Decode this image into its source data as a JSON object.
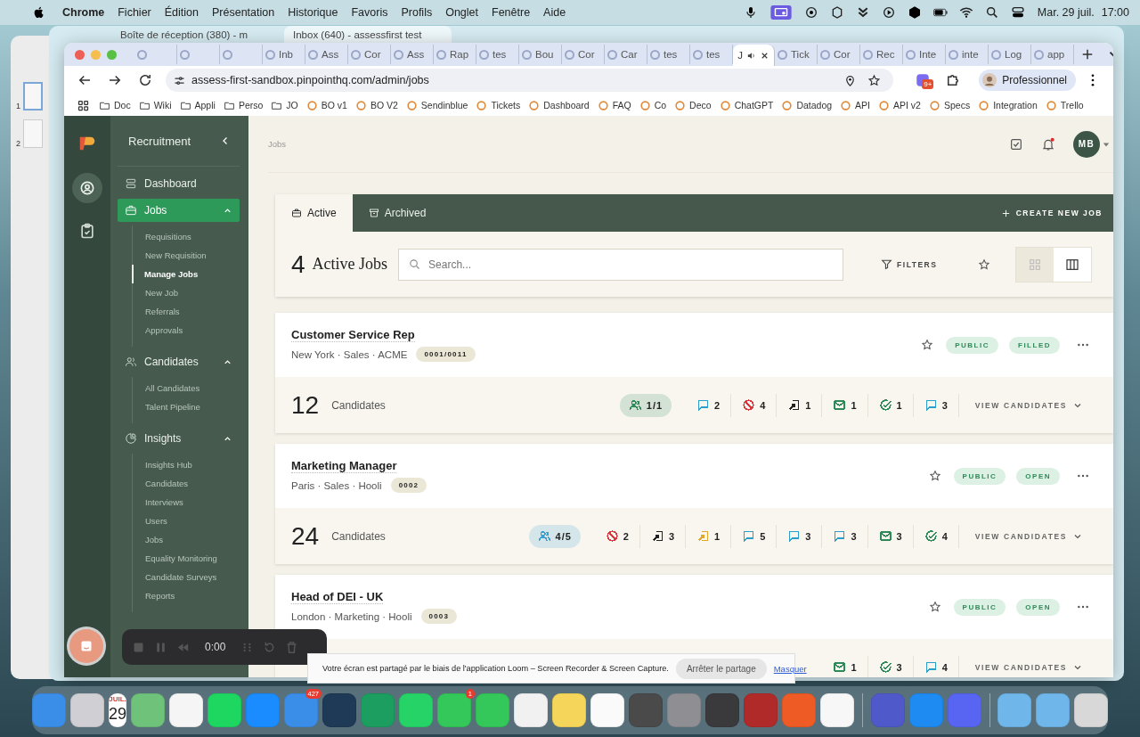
{
  "menu_bar": {
    "app": "Chrome",
    "menus": [
      "Fichier",
      "Édition",
      "Présentation",
      "Historique",
      "Favoris",
      "Profils",
      "Onglet",
      "Fenêtre",
      "Aide"
    ],
    "date": "Mar. 29 juil.",
    "time": "17:00"
  },
  "back_window": {
    "slides": [
      {
        "number": "1",
        "selected": true
      },
      {
        "number": "2",
        "selected": false
      }
    ],
    "tabs": [
      {
        "title": "Boîte de réception (380) - m",
        "selected": false
      },
      {
        "title": "Inbox (640) - assessfirst test",
        "selected": true
      }
    ]
  },
  "browser": {
    "tabs": [
      {
        "selected": false
      },
      {
        "selected": false
      },
      {
        "selected": false
      },
      {
        "label": "Inb",
        "selected": false
      },
      {
        "label": "Ass",
        "selected": false
      },
      {
        "label": "Cor",
        "selected": false
      },
      {
        "label": "Ass",
        "selected": false
      },
      {
        "label": "Rap",
        "selected": false
      },
      {
        "label": "tes",
        "selected": false
      },
      {
        "label": "Bou",
        "selected": false
      },
      {
        "label": "Cor",
        "selected": false
      },
      {
        "label": "Car",
        "selected": false
      },
      {
        "label": "tes",
        "selected": false
      },
      {
        "label": "tes",
        "selected": false
      },
      {
        "label": "J",
        "selected": true
      },
      {
        "label": "Tick",
        "selected": false
      },
      {
        "label": "Cor",
        "selected": false
      },
      {
        "label": "Rec",
        "selected": false
      },
      {
        "label": "Inte",
        "selected": false
      },
      {
        "label": "inte",
        "selected": false
      },
      {
        "label": "Log",
        "selected": false
      },
      {
        "label": "app",
        "selected": false
      }
    ],
    "url": "assess-first-sandbox.pinpointhq.com/admin/jobs",
    "extension_badge": "9+",
    "profile": "Professionnel",
    "bookmarks": [
      {
        "kind": "folder",
        "label": "Doc"
      },
      {
        "kind": "folder",
        "label": "Wiki"
      },
      {
        "kind": "folder",
        "label": "Appli"
      },
      {
        "kind": "folder",
        "label": "Perso"
      },
      {
        "kind": "folder",
        "label": "JO"
      },
      {
        "kind": "site",
        "label": "BO v1"
      },
      {
        "kind": "site",
        "label": "BO V2"
      },
      {
        "kind": "site",
        "label": "Sendinblue"
      },
      {
        "kind": "site",
        "label": "Tickets"
      },
      {
        "kind": "site",
        "label": "Dashboard"
      },
      {
        "kind": "site",
        "label": "FAQ"
      },
      {
        "kind": "site",
        "label": "Co"
      },
      {
        "kind": "site",
        "label": "Deco"
      },
      {
        "kind": "site",
        "label": "ChatGPT"
      },
      {
        "kind": "site",
        "label": "Datadog"
      },
      {
        "kind": "site",
        "label": "API"
      },
      {
        "kind": "site",
        "label": "API v2"
      },
      {
        "kind": "site",
        "label": "Specs"
      },
      {
        "kind": "site",
        "label": "Integration"
      },
      {
        "kind": "site",
        "label": "Trello"
      }
    ]
  },
  "app": {
    "rail": [
      {
        "selected": true
      },
      {
        "selected": false
      }
    ],
    "sidebar": {
      "title": "Recruitment",
      "items": [
        {
          "label": "Dashboard",
          "selected": false,
          "kind": "link"
        },
        {
          "label": "Jobs",
          "selected": true,
          "kind": "group",
          "expanded": true,
          "children": [
            {
              "label": "Requisitions",
              "selected": false
            },
            {
              "label": "New Requisition",
              "selected": false
            },
            {
              "label": "Manage Jobs",
              "selected": true
            },
            {
              "label": "New Job",
              "selected": false
            },
            {
              "label": "Referrals",
              "selected": false
            },
            {
              "label": "Approvals",
              "selected": false
            }
          ]
        },
        {
          "label": "Candidates",
          "selected": false,
          "kind": "group",
          "expanded": true,
          "children": [
            {
              "label": "All Candidates",
              "selected": false
            },
            {
              "label": "Talent Pipeline",
              "selected": false
            }
          ]
        },
        {
          "label": "Insights",
          "selected": false,
          "kind": "group",
          "expanded": true,
          "children": [
            {
              "label": "Insights Hub",
              "selected": false
            },
            {
              "label": "Candidates",
              "selected": false
            },
            {
              "label": "Interviews",
              "selected": false
            },
            {
              "label": "Users",
              "selected": false
            },
            {
              "label": "Jobs",
              "selected": false
            },
            {
              "label": "Equality Monitoring",
              "selected": false
            },
            {
              "label": "Candidate Surveys",
              "selected": false
            },
            {
              "label": "Reports",
              "selected": false
            }
          ]
        }
      ]
    },
    "breadcrumb": "Jobs",
    "notification_unread": true,
    "avatar": "MB",
    "job_tabs": [
      {
        "label": "Active",
        "selected": true
      },
      {
        "label": "Archived",
        "selected": false
      }
    ],
    "create_button": "CREATE NEW JOB",
    "count": "4",
    "heading": "Active Jobs",
    "search": {
      "placeholder": "Search..."
    },
    "filters": "FILTERS",
    "views": [
      {
        "selected": true
      },
      {
        "selected": false
      }
    ],
    "jobs": [
      {
        "title": "Customer Service Rep",
        "meta": "New York · Sales · ACME",
        "ref": "0001/0011",
        "starred": false,
        "badges": [
          "PUBLIC",
          "FILLED"
        ],
        "count": "12",
        "count_label": "Candidates",
        "view": "VIEW CANDIDATES",
        "stats": [
          {
            "kind": "team",
            "value": "1/1",
            "color": "#2f8a5a"
          },
          {
            "kind": "message",
            "value": "2",
            "color": "#2a9fc9"
          },
          {
            "kind": "reject",
            "value": "4",
            "color": "#d9363e"
          },
          {
            "kind": "move",
            "value": "1",
            "color": "#222222"
          },
          {
            "kind": "mail",
            "value": "1",
            "color": "#2f8a5a"
          },
          {
            "kind": "check",
            "value": "1",
            "color": "#2f8a5a"
          },
          {
            "kind": "message",
            "value": "3",
            "color": "#2a9fc9"
          }
        ]
      },
      {
        "title": "Marketing Manager",
        "meta": "Paris · Sales · Hooli",
        "ref": "0002",
        "starred": false,
        "badges": [
          "PUBLIC",
          "OPEN"
        ],
        "count": "24",
        "count_label": "Candidates",
        "view": "VIEW CANDIDATES",
        "stats": [
          {
            "kind": "team",
            "value": "4/5",
            "color": "#3a9fd0"
          },
          {
            "kind": "reject",
            "value": "2",
            "color": "#d9363e"
          },
          {
            "kind": "move",
            "value": "3",
            "color": "#222222"
          },
          {
            "kind": "move",
            "value": "1",
            "color": "#e0a82a"
          },
          {
            "kind": "message",
            "value": "5",
            "color": "#2a9fc9"
          },
          {
            "kind": "message",
            "value": "3",
            "color": "#2a9fc9"
          },
          {
            "kind": "message",
            "value": "3",
            "color": "#2a9fc9"
          },
          {
            "kind": "mail",
            "value": "3",
            "color": "#2f8a5a"
          },
          {
            "kind": "check",
            "value": "4",
            "color": "#2f8a5a"
          }
        ]
      },
      {
        "title": "Head of DEI - UK",
        "meta": "London · Marketing · Hooli",
        "ref": "0003",
        "starred": false,
        "badges": [
          "PUBLIC",
          "OPEN"
        ],
        "view": "VIEW CANDIDATES",
        "stats": [
          {
            "kind": "mail",
            "value": "1",
            "color": "#2f8a5a"
          },
          {
            "kind": "check",
            "value": "3",
            "color": "#2f8a5a"
          },
          {
            "kind": "message",
            "value": "4",
            "color": "#2a9fc9"
          }
        ]
      }
    ]
  },
  "loom": {
    "timer": "0:00",
    "banner": "Votre écran est partagé par le biais de l'application Loom – Screen Recorder & Screen Capture.",
    "stop": "Arrêter le partage",
    "hide": "Masquer"
  },
  "dock": [
    {
      "kind": "app",
      "color": "#3b8ee8"
    },
    {
      "kind": "app",
      "color": "#cfcfd4"
    },
    {
      "kind": "calendar",
      "color": "#ffffff",
      "month": "JUIL.",
      "day": "29"
    },
    {
      "kind": "app",
      "color": "#6fc27a"
    },
    {
      "kind": "app",
      "color": "#f5f5f5"
    },
    {
      "kind": "app",
      "color": "#1ed760"
    },
    {
      "kind": "app",
      "color": "#1a8cff"
    },
    {
      "kind": "app",
      "color": "#3b8ee8",
      "badge": "427"
    },
    {
      "kind": "app",
      "color": "#1f3a56"
    },
    {
      "kind": "app",
      "color": "#1b9e5f"
    },
    {
      "kind": "app",
      "color": "#25d366"
    },
    {
      "kind": "app",
      "color": "#34c759",
      "badge": "1"
    },
    {
      "kind": "app",
      "color": "#34c759"
    },
    {
      "kind": "app",
      "color": "#f1f1f1"
    },
    {
      "kind": "app",
      "color": "#f6d65a"
    },
    {
      "kind": "app",
      "color": "#fafafa"
    },
    {
      "kind": "app",
      "color": "#4a4a4a"
    },
    {
      "kind": "app",
      "color": "#8e8e93"
    },
    {
      "kind": "app",
      "color": "#3a3a3c"
    },
    {
      "kind": "app",
      "color": "#b02a2a"
    },
    {
      "kind": "app",
      "color": "#ef5b25"
    },
    {
      "kind": "app",
      "color": "#f7f7f7"
    },
    {
      "kind": "separator"
    },
    {
      "kind": "app",
      "color": "#5059c9"
    },
    {
      "kind": "app",
      "color": "#1d8bf1"
    },
    {
      "kind": "app",
      "color": "#5865f2"
    },
    {
      "kind": "separator"
    },
    {
      "kind": "app",
      "color": "#6fb6ea"
    },
    {
      "kind": "app",
      "color": "#6fb6ea"
    },
    {
      "kind": "app",
      "color": "#d8d8d8"
    }
  ]
}
